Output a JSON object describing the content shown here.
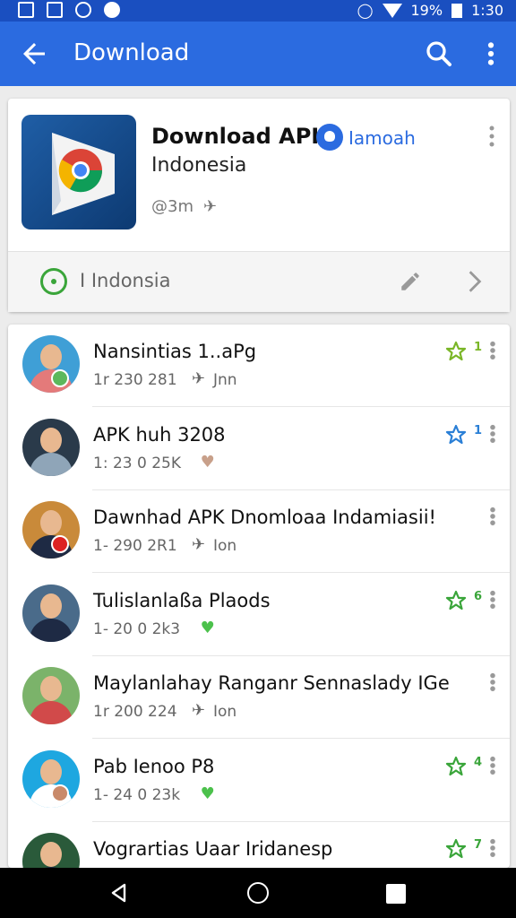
{
  "status_bar": {
    "battery": "19%",
    "time": "1:30"
  },
  "app_bar": {
    "title": "Download"
  },
  "header_card": {
    "title": "Download APK",
    "publisher": "Iamoah",
    "subtitle": "Indonesia",
    "meta": "@3m",
    "region": "I Indonsia"
  },
  "list": {
    "items": [
      {
        "title": "Nansintias 1..aPg",
        "meta": "1r 230 281",
        "tail": "Jnn",
        "meta_icon": "plane-icon",
        "fav_count": "1",
        "fav_color": "#7ab627",
        "avatar_bg": "#3f9fd6",
        "body_color": "#e47a7a",
        "badge_color": "#5cb85c"
      },
      {
        "title": "APK huh 3208",
        "meta": "1: 23 0 25K",
        "tail": "",
        "meta_icon": "heart-icon",
        "fav_count": "1",
        "fav_color": "#2a7fd6",
        "avatar_bg": "#2a3a4a",
        "body_color": "#8fa5b8",
        "badge_color": ""
      },
      {
        "title": "Dawnhad APK Dnomloaa Indamiasii!",
        "meta": "1- 290 2R1",
        "tail": "Ion",
        "meta_icon": "plane-icon",
        "fav_count": "",
        "fav_color": "",
        "avatar_bg": "#c98a3a",
        "body_color": "#1e2a44",
        "badge_color": "#d22"
      },
      {
        "title": "Tulislanlaßa Plaods",
        "meta": "1- 20 0 2k3",
        "tail": "",
        "meta_icon": "heart-icon",
        "fav_count": "6",
        "fav_color": "#3aa53a",
        "avatar_bg": "#4a6b8a",
        "body_color": "#1e2a44",
        "badge_color": ""
      },
      {
        "title": "Maylanlahay Ranganr Sennaslady IGe",
        "meta": "1r 200 224",
        "tail": "Ion",
        "meta_icon": "plane-icon",
        "fav_count": "",
        "fav_color": "",
        "avatar_bg": "#7bb36a",
        "body_color": "#d14a4a",
        "badge_color": ""
      },
      {
        "title": "Pab Ienoo P8",
        "meta": "1- 24 0 23k",
        "tail": "",
        "meta_icon": "heart-icon",
        "fav_count": "4",
        "fav_color": "#3aa53a",
        "avatar_bg": "#1ea7e0",
        "body_color": "#ffffff",
        "badge_color": "#c98a6a"
      },
      {
        "title": "Vogrartias Uaar Iridanesp",
        "meta": "",
        "tail": "",
        "meta_icon": "",
        "fav_count": "7",
        "fav_color": "#3aa53a",
        "avatar_bg": "#2a5a3a",
        "body_color": "#1e2a44",
        "badge_color": ""
      }
    ]
  }
}
